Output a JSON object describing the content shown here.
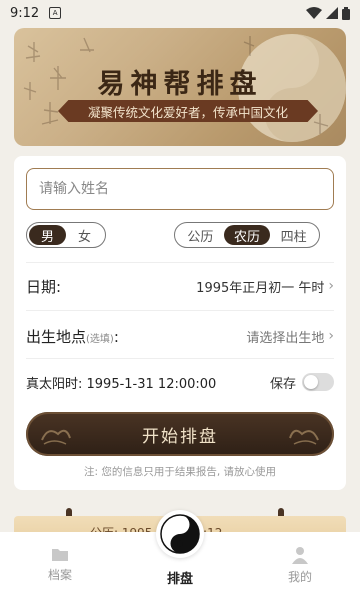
{
  "status_bar": {
    "time": "9:12",
    "app_icon_letter": "A"
  },
  "banner": {
    "title": "易神帮排盘",
    "subtitle": "凝聚传统文化爱好者，传承中国文化"
  },
  "form": {
    "name_placeholder": "请输入姓名",
    "gender_options": [
      {
        "label": "男",
        "active": true
      },
      {
        "label": "女",
        "active": false
      }
    ],
    "calendar_options": [
      {
        "label": "公历",
        "active": false
      },
      {
        "label": "农历",
        "active": true
      },
      {
        "label": "四柱",
        "active": false
      }
    ],
    "date_label": "日期:",
    "date_value": "1995年正月初一 午时",
    "birthplace_label": "出生地点",
    "birthplace_optional": "(选填)",
    "birthplace_colon": ":",
    "birthplace_value": "请选择出生地",
    "solar_time_text": "真太阳时: 1995-1-31 12:00:00",
    "save_label": "保存",
    "save_on": false,
    "start_button": "开始排盘",
    "note": "注: 您的信息只用于结果报告, 请放心使用"
  },
  "preview": {
    "text": "公历: 1995-1-31 09:12"
  },
  "bottom_nav": {
    "archive": "档案",
    "chart": "排盘",
    "profile": "我的"
  },
  "colors": {
    "accent_dark": "#3a2a1e",
    "input_border": "#a07c52",
    "ribbon": "#6a3a22"
  }
}
